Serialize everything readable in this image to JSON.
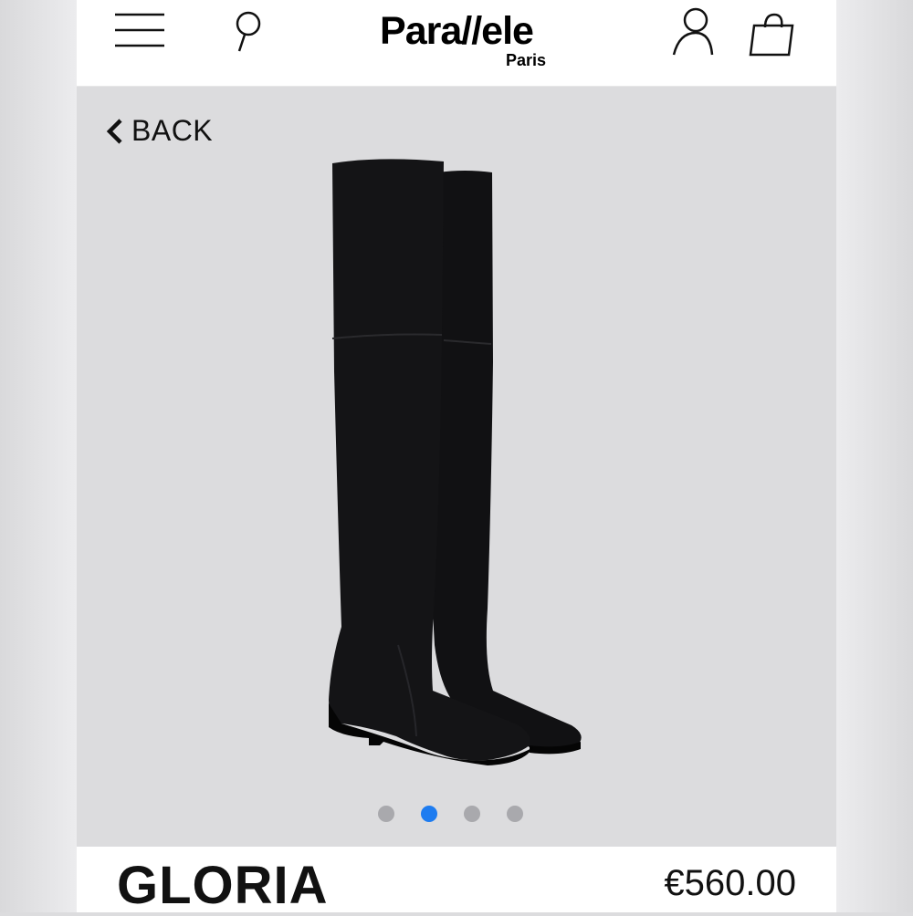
{
  "header": {
    "brand_name": "Para//ele",
    "brand_city": "Paris",
    "icons": [
      "menu-icon",
      "search-icon",
      "account-icon",
      "shopping-bag-icon"
    ]
  },
  "hero": {
    "back_label": "BACK",
    "back_icon": "chevron-left-icon",
    "image_subject": "black over-the-knee suede boots",
    "carousel": {
      "total": 4,
      "active_index": 1
    }
  },
  "product": {
    "name": "GLORIA",
    "price": "€560.00"
  },
  "colors": {
    "accent": "#1e7cf0",
    "hero_background": "#dcdcde",
    "dot_inactive": "#a9a9ad"
  }
}
